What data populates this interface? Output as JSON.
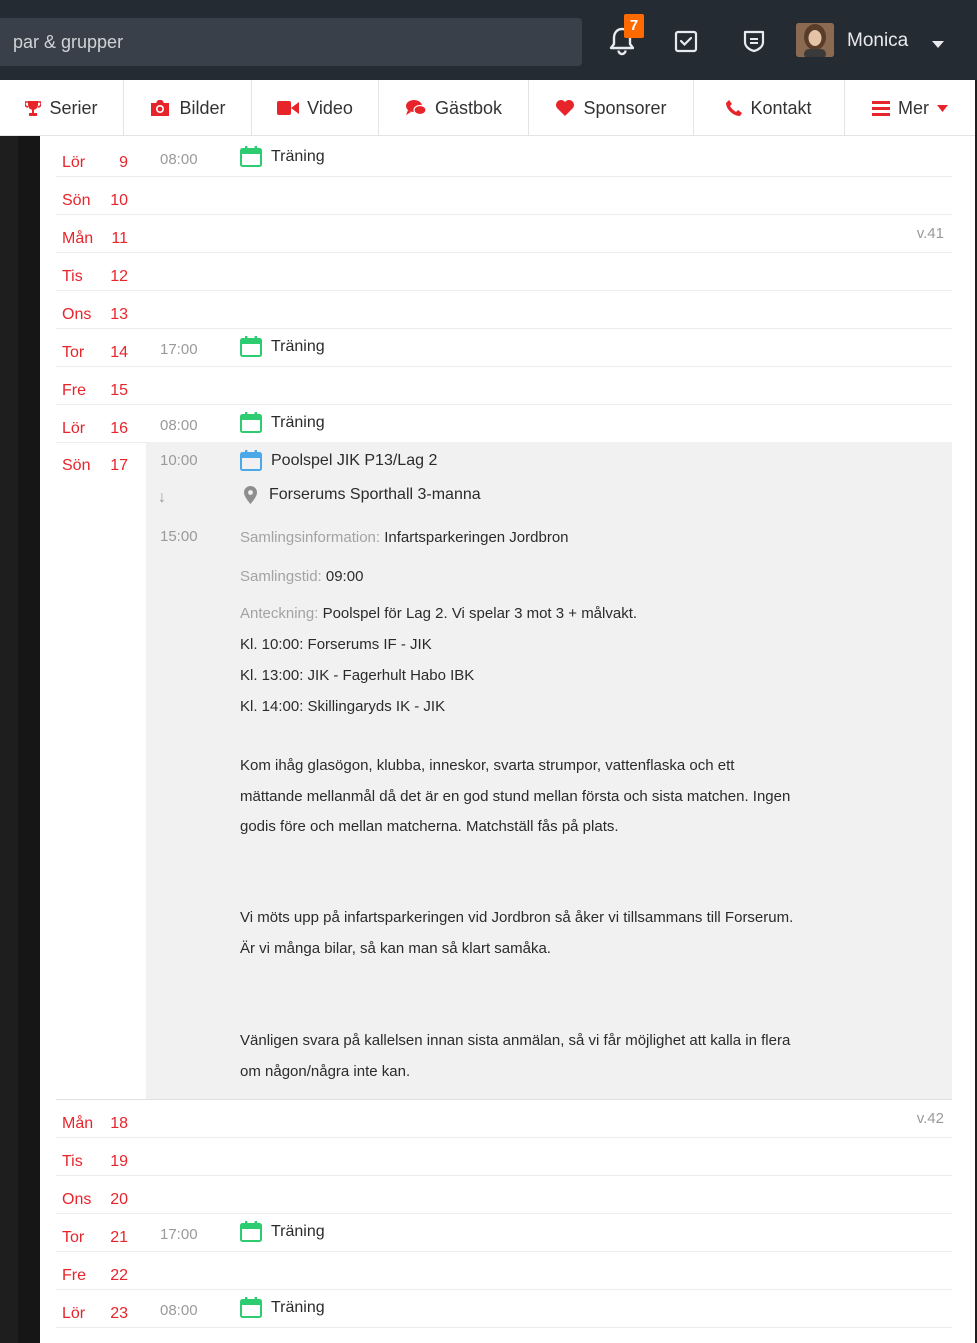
{
  "topbar": {
    "search_placeholder": "par & grupper",
    "notification_count": "7",
    "username": "Monica"
  },
  "nav": [
    {
      "label": "Serier",
      "icon": "trophy-icon"
    },
    {
      "label": "Bilder",
      "icon": "camera-icon"
    },
    {
      "label": "Video",
      "icon": "video-icon"
    },
    {
      "label": "Gästbok",
      "icon": "chat-bubbles-icon"
    },
    {
      "label": "Sponsorer",
      "icon": "heart-icon"
    },
    {
      "label": "Kontakt",
      "icon": "phone-icon"
    },
    {
      "label": "Mer",
      "icon": "menu-icon"
    }
  ],
  "colors": {
    "accent_red": "#e8242b",
    "topbar_bg": "#252b33",
    "badge_orange": "#ff6a00",
    "training_icon_green": "#2ecc71",
    "match_icon_blue": "#4aa8e8"
  },
  "calendar": {
    "rows": [
      {
        "day": "Lör",
        "num": "9",
        "time": "08:00",
        "event": "Träning",
        "week": ""
      },
      {
        "day": "Sön",
        "num": "10",
        "time": "",
        "event": "",
        "week": ""
      },
      {
        "day": "Mån",
        "num": "11",
        "time": "",
        "event": "",
        "week": "v.41"
      },
      {
        "day": "Tis",
        "num": "12",
        "time": "",
        "event": "",
        "week": ""
      },
      {
        "day": "Ons",
        "num": "13",
        "time": "",
        "event": "",
        "week": ""
      },
      {
        "day": "Tor",
        "num": "14",
        "time": "17:00",
        "event": "Träning",
        "week": ""
      },
      {
        "day": "Fre",
        "num": "15",
        "time": "",
        "event": "",
        "week": ""
      },
      {
        "day": "Lör",
        "num": "16",
        "time": "08:00",
        "event": "Träning",
        "week": ""
      }
    ],
    "expanded": {
      "day": "Sön",
      "num": "17",
      "start_time": "10:00",
      "end_time": "15:00",
      "arrow": "↓",
      "title": "Poolspel JIK P13/Lag 2",
      "location": "Forserums Sporthall 3-manna",
      "samling_info_label": "Samlingsinformation:",
      "samling_info_value": "Infartsparkeringen Jordbron",
      "samling_tid_label": "Samlingstid:",
      "samling_tid_value": "09:00",
      "note_label": "Anteckning:",
      "note_first": "Poolspel för Lag 2. Vi spelar 3 mot 3 + målvakt.",
      "note_lines": [
        "Kl. 10:00: Forserums IF - JIK",
        "Kl. 13:00: JIK - Fagerhult Habo IBK",
        "Kl. 14:00: Skillingaryds IK - JIK"
      ],
      "para1": "Kom ihåg glasögon, klubba, inneskor, svarta strumpor, vattenflaska och ett mättande mellanmål då det är en god stund mellan första och sista matchen. Ingen godis före och mellan matcherna. Matchställ fås på plats.",
      "para2": "Vi möts upp på infartsparkeringen vid Jordbron så åker vi tillsammans till Forserum. Är vi många bilar, så kan man så klart samåka.",
      "para3": "Vänligen svara på kallelsen innan sista anmälan, så vi får möjlighet att kalla in flera om någon/några inte kan."
    },
    "rows_after": [
      {
        "day": "Mån",
        "num": "18",
        "time": "",
        "event": "",
        "week": "v.42"
      },
      {
        "day": "Tis",
        "num": "19",
        "time": "",
        "event": "",
        "week": ""
      },
      {
        "day": "Ons",
        "num": "20",
        "time": "",
        "event": "",
        "week": ""
      },
      {
        "day": "Tor",
        "num": "21",
        "time": "17:00",
        "event": "Träning",
        "week": ""
      },
      {
        "day": "Fre",
        "num": "22",
        "time": "",
        "event": "",
        "week": ""
      },
      {
        "day": "Lör",
        "num": "23",
        "time": "08:00",
        "event": "Träning",
        "week": ""
      }
    ]
  }
}
